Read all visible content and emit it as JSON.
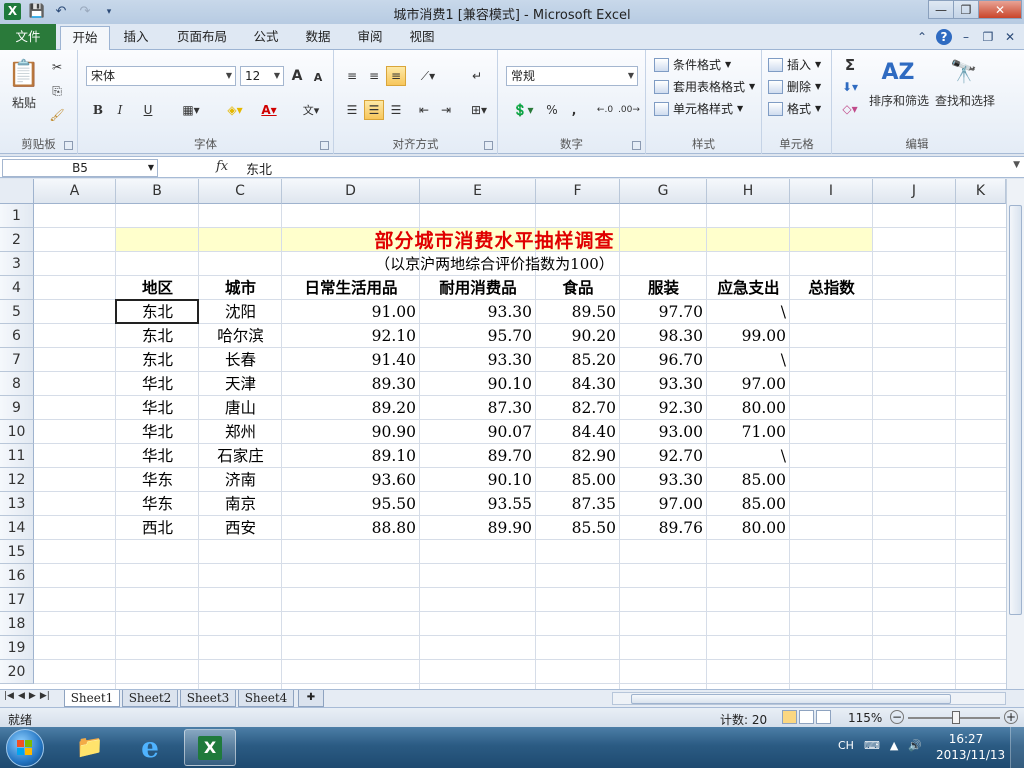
{
  "window": {
    "title": "城市消费1 [兼容模式] - Microsoft Excel",
    "app_icon": "X"
  },
  "ribbon_tabs": [
    {
      "label": "文件",
      "name": "tab-file"
    },
    {
      "label": "开始",
      "name": "tab-home"
    },
    {
      "label": "插入",
      "name": "tab-insert"
    },
    {
      "label": "页面布局",
      "name": "tab-page-layout"
    },
    {
      "label": "公式",
      "name": "tab-formulas"
    },
    {
      "label": "数据",
      "name": "tab-data"
    },
    {
      "label": "审阅",
      "name": "tab-review"
    },
    {
      "label": "视图",
      "name": "tab-view"
    }
  ],
  "ribbon": {
    "clipboard": {
      "label": "剪贴板",
      "paste": "粘贴"
    },
    "font": {
      "label": "字体",
      "font_name": "宋体",
      "font_size": "12",
      "bold": "B",
      "italic": "I",
      "underline": "U",
      "grow": "A",
      "shrink": "A"
    },
    "alignment": {
      "label": "对齐方式"
    },
    "number": {
      "label": "数字",
      "format": "常规",
      "percent": "%",
      "comma": ","
    },
    "styles": {
      "label": "样式",
      "conditional": "条件格式",
      "table": "套用表格格式",
      "cell": "单元格样式"
    },
    "cells": {
      "label": "单元格",
      "insert": "插入",
      "delete": "删除",
      "format": "格式"
    },
    "editing": {
      "label": "编辑",
      "sort": "排序和筛选",
      "find": "查找和选择",
      "sum": "Σ"
    }
  },
  "formula_bar": {
    "name_box": "B5",
    "fx": "fx",
    "content": "东北"
  },
  "columns": [
    "A",
    "B",
    "C",
    "D",
    "E",
    "F",
    "G",
    "H",
    "I",
    "J",
    "K"
  ],
  "rows": [
    "1",
    "2",
    "3",
    "4",
    "5",
    "6",
    "7",
    "8",
    "9",
    "10",
    "11",
    "12",
    "13",
    "14",
    "15",
    "16",
    "17",
    "18",
    "19",
    "20"
  ],
  "sheet": {
    "title": "部分城市消费水平抽样调查",
    "subtitle": "（以京沪两地综合评价指数为100）",
    "headers": [
      "地区",
      "城市",
      "日常生活用品",
      "耐用消费品",
      "食品",
      "服装",
      "应急支出",
      "总指数"
    ],
    "data": [
      [
        "东北",
        "沈阳",
        "91.00",
        "93.30",
        "89.50",
        "97.70",
        "\\",
        ""
      ],
      [
        "东北",
        "哈尔滨",
        "92.10",
        "95.70",
        "90.20",
        "98.30",
        "99.00",
        ""
      ],
      [
        "东北",
        "长春",
        "91.40",
        "93.30",
        "85.20",
        "96.70",
        "\\",
        ""
      ],
      [
        "华北",
        "天津",
        "89.30",
        "90.10",
        "84.30",
        "93.30",
        "97.00",
        ""
      ],
      [
        "华北",
        "唐山",
        "89.20",
        "87.30",
        "82.70",
        "92.30",
        "80.00",
        ""
      ],
      [
        "华北",
        "郑州",
        "90.90",
        "90.07",
        "84.40",
        "93.00",
        "71.00",
        ""
      ],
      [
        "华北",
        "石家庄",
        "89.10",
        "89.70",
        "82.90",
        "92.70",
        "\\",
        ""
      ],
      [
        "华东",
        "济南",
        "93.60",
        "90.10",
        "85.00",
        "93.30",
        "85.00",
        ""
      ],
      [
        "华东",
        "南京",
        "95.50",
        "93.55",
        "87.35",
        "97.00",
        "85.00",
        ""
      ],
      [
        "西北",
        "西安",
        "88.80",
        "89.90",
        "85.50",
        "89.76",
        "80.00",
        ""
      ]
    ]
  },
  "sheet_tabs": [
    "Sheet1",
    "Sheet2",
    "Sheet3",
    "Sheet4"
  ],
  "status": {
    "ready": "就绪",
    "count": "计数: 20",
    "zoom": "115%"
  },
  "taskbar": {
    "lang": "CH",
    "time": "16:27",
    "date": "2013/11/13"
  },
  "colors": {
    "title_red": "#e00000",
    "title_band": "#ffffcc",
    "file_tab": "#2a7a3a"
  }
}
